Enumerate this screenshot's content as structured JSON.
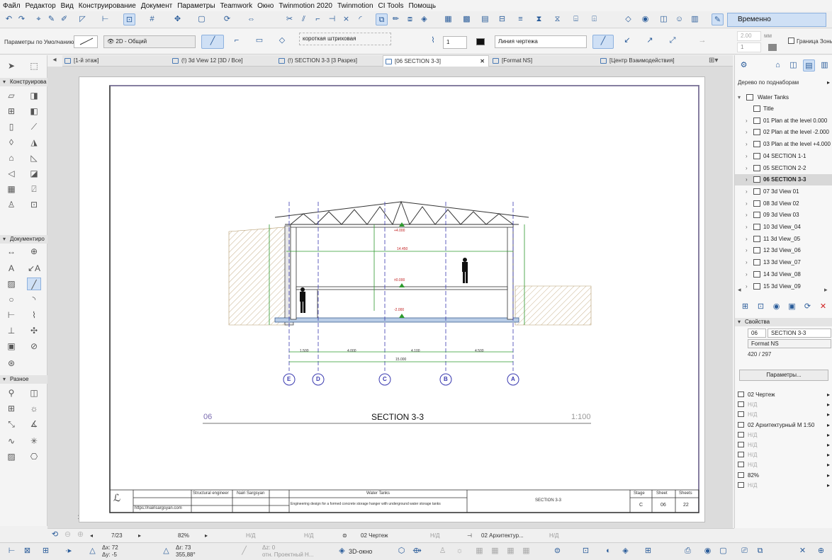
{
  "menu": [
    "Файл",
    "Редактор",
    "Вид",
    "Конструирование",
    "Документ",
    "Параметры",
    "Teamwork",
    "Окно",
    "Twinmotion 2020",
    "Twinmotion",
    "CI Tools",
    "Помощь"
  ],
  "toolbar": {
    "regroup_label": "Временно Разгруппировать"
  },
  "infobox": {
    "defaults_label": "Параметры по Умолчанию",
    "layer_value": "2D - Общий",
    "line_type_value": "короткая штриховая",
    "pen_value": "1",
    "line_category_value": "Линия чертежа",
    "units_label": "мм",
    "spin1": "2.00",
    "spin2": "1",
    "zone_border_label": "Граница Зоны"
  },
  "tabs": [
    {
      "label": "[1-й этаж]"
    },
    {
      "label": "(!) 3d View 12 [3D / Все]"
    },
    {
      "label": "(!) SECTION 3-3 [3 Разрез]"
    },
    {
      "label": "[06 SECTION 3-3]"
    },
    {
      "label": "[Format NS]"
    },
    {
      "label": "[Центр Взаимодействия]"
    }
  ],
  "toolbox": {
    "design_header": "Конструирова",
    "document_header": "Документиро",
    "misc_header": "Разное"
  },
  "drawing": {
    "level_top": "+4.000",
    "level_mid": "±0.000",
    "level_bottom": "-2.000",
    "dim_height": "14.450",
    "dim_segments": [
      "1.500",
      "4.000",
      "4.100",
      "4.500"
    ],
    "dim_total": "15.000",
    "axes": [
      "E",
      "D",
      "C",
      "B",
      "A"
    ],
    "title_number": "06",
    "title": "SECTION 3-3",
    "scale": "1:100"
  },
  "titleblock": {
    "role": "Structural engineer",
    "name": "Nairi Sargsyan",
    "website": "https://nairisargsyan.com",
    "project": "Water Tanks",
    "description": "Engineering design for a formed concrete storage hanger with underground water storage tanks",
    "sheet_title": "SECTION 3-3",
    "stage_label": "Stage",
    "stage": "C",
    "sheet_label": "Sheet",
    "sheet": "06",
    "sheets_label": "Sheets",
    "sheets": "22"
  },
  "navigator": {
    "header": "Дерево по поднаборам",
    "root": "Water Tanks",
    "items": [
      "Title",
      "01 Plan at the level 0.000",
      "02 Plan at the level -2.000",
      "03 Plan at the level +4.000",
      "04 SECTION 1-1",
      "05 SECTION 2-2",
      "06 SECTION 3-3",
      "07 3d View 01",
      "08 3d View 02",
      "09 3d View 03",
      "10 3d View_04",
      "11 3d View_05",
      "12 3d View_06",
      "13 3d View_07",
      "14 3d View_08",
      "15 3d View_09"
    ],
    "selected_index": 6
  },
  "properties": {
    "header": "Свойства",
    "number": "06",
    "name": "SECTION 3-3",
    "master": "Format NS",
    "size": "420 / 297",
    "button": "Параметры...",
    "rows": [
      "02 Чертеж",
      "Н/Д",
      "Н/Д",
      "02 Архитектурный М 1:50",
      "Н/Д",
      "Н/Д",
      "Н/Д",
      "Н/Д",
      "82%",
      "Н/Д"
    ]
  },
  "statusbar": {
    "page": "7/23",
    "zoom": "82%",
    "na1": "Н/Д",
    "na2": "Н/Д",
    "layer_combo": "02 Чертеж",
    "na3": "Н/Д",
    "dim_combo": "02 Архитектур...",
    "na4": "Н/Д"
  },
  "coords": {
    "dx": "Δx: 72",
    "dy": "Δy: -5",
    "dr": "Δr: 73",
    "angle": "355,88°",
    "dz": "Δz: 0",
    "ref": "отн. Проектный Н...",
    "view3d": "3D-окно"
  }
}
